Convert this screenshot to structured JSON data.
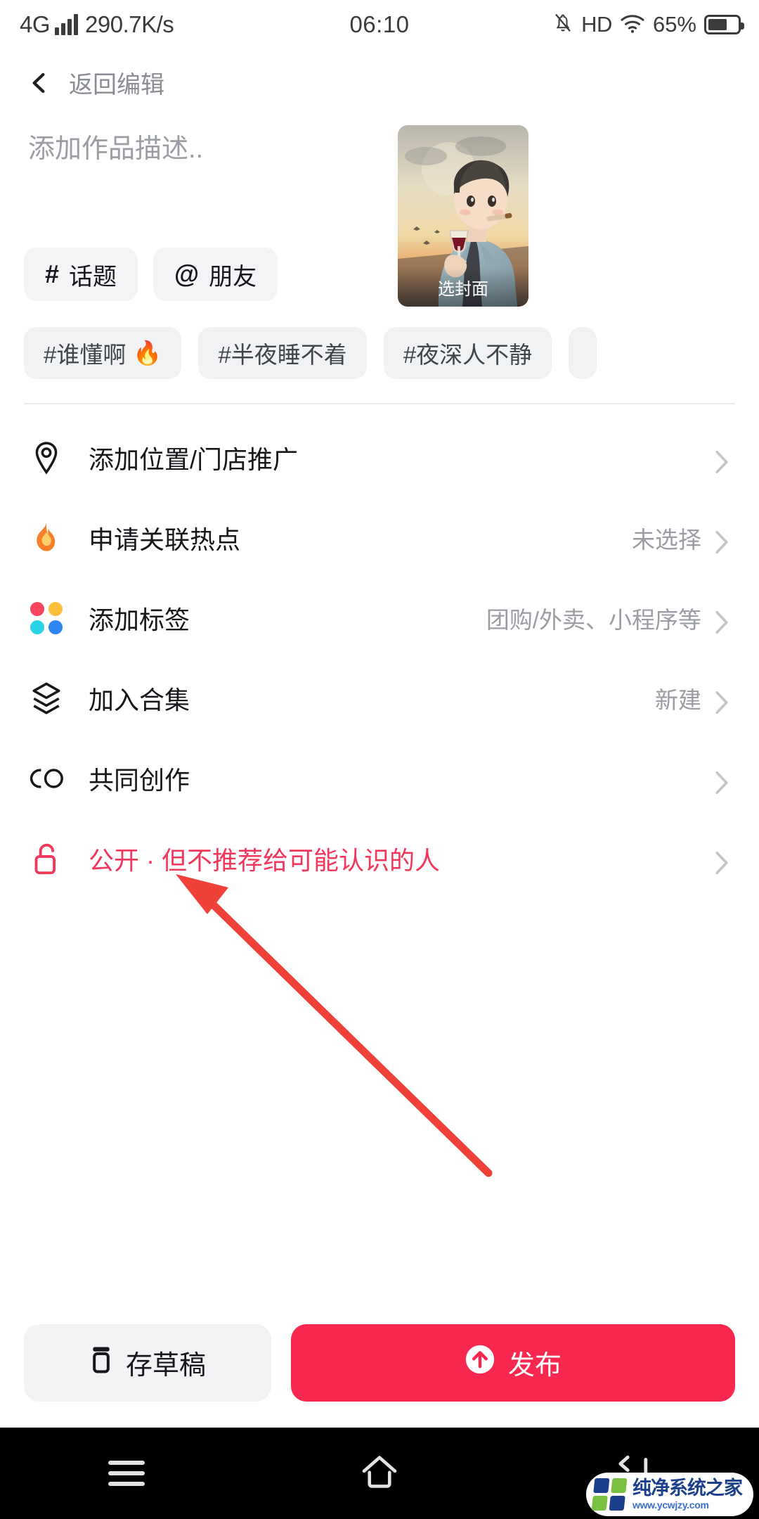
{
  "statusbar": {
    "network_type": "4G",
    "speed": "290.7K/s",
    "time": "06:10",
    "hd": "HD",
    "battery_percent": "65%",
    "icons": [
      "signal-bars-icon",
      "mute-bell-icon",
      "hd-icon",
      "wifi-icon",
      "battery-icon"
    ]
  },
  "nav": {
    "back_label": "返回编辑"
  },
  "description": {
    "placeholder": "添加作品描述.."
  },
  "cover": {
    "label": "选封面"
  },
  "chips": [
    {
      "glyph": "#",
      "label": "话题",
      "name": "topic"
    },
    {
      "glyph": "@",
      "label": "朋友",
      "name": "friend"
    }
  ],
  "tag_suggestions": [
    {
      "text": "#谁懂啊",
      "flame": "🔥"
    },
    {
      "text": "#半夜睡不着",
      "flame": ""
    },
    {
      "text": "#夜深人不静",
      "flame": ""
    },
    {
      "text": "",
      "flame": ""
    }
  ],
  "rows": [
    {
      "icon": "location-pin-icon",
      "label": "添加位置/门店推广",
      "value": ""
    },
    {
      "icon": "flame-icon",
      "label": "申请关联热点",
      "value": "未选择"
    },
    {
      "icon": "four-dots-icon",
      "label": "添加标签",
      "value": "团购/外卖、小程序等"
    },
    {
      "icon": "layers-icon",
      "label": "加入合集",
      "value": "新建"
    },
    {
      "icon": "co-create-icon",
      "label": "共同创作",
      "value": ""
    },
    {
      "icon": "unlock-icon",
      "label": "公开 · 但不推荐给可能认识的人",
      "value": ""
    }
  ],
  "bottom": {
    "draft_label": "存草稿",
    "publish_label": "发布"
  },
  "android_nav": [
    "menu-icon",
    "home-icon",
    "back-icon"
  ],
  "watermark": {
    "name": "纯净系统之家",
    "url": "www.ycwjzy.com"
  },
  "colors": {
    "accent_publish": "#f7274f",
    "privacy_text": "#f2385a",
    "chip_bg": "#f3f4f5",
    "muted_text": "#9a9da3",
    "annotation_arrow": "#ef4138",
    "dot_red": "#f5455f",
    "dot_yellow": "#fcbf3b",
    "dot_cyan": "#2ad4e6",
    "dot_blue": "#2f86f0",
    "flame_icon": "#f77f2a"
  }
}
